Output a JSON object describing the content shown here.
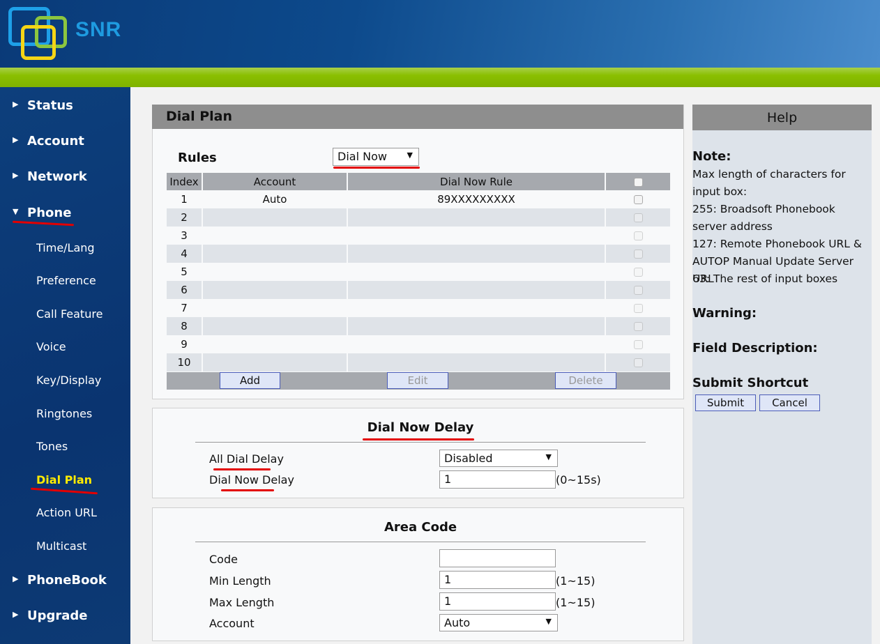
{
  "header": {
    "logo_text": "SNR"
  },
  "sidebar": {
    "items": [
      {
        "label": "Status"
      },
      {
        "label": "Account"
      },
      {
        "label": "Network"
      },
      {
        "label": "Phone"
      },
      {
        "label": "PhoneBook"
      },
      {
        "label": "Upgrade"
      }
    ],
    "phone_sub": [
      {
        "label": "Time/Lang"
      },
      {
        "label": "Preference"
      },
      {
        "label": "Call Feature"
      },
      {
        "label": "Voice"
      },
      {
        "label": "Key/Display"
      },
      {
        "label": "Ringtones"
      },
      {
        "label": "Tones"
      },
      {
        "label": "Dial Plan"
      },
      {
        "label": "Action URL"
      },
      {
        "label": "Multicast"
      }
    ]
  },
  "dialplan": {
    "title": "Dial Plan",
    "rules_label": "Rules",
    "rules_select": "Dial Now",
    "columns": [
      "Index",
      "Account",
      "Dial Now Rule"
    ],
    "rows": [
      {
        "index": "1",
        "account": "Auto",
        "rule": "89XXXXXXXXX"
      },
      {
        "index": "2",
        "account": "",
        "rule": ""
      },
      {
        "index": "3",
        "account": "",
        "rule": ""
      },
      {
        "index": "4",
        "account": "",
        "rule": ""
      },
      {
        "index": "5",
        "account": "",
        "rule": ""
      },
      {
        "index": "6",
        "account": "",
        "rule": ""
      },
      {
        "index": "7",
        "account": "",
        "rule": ""
      },
      {
        "index": "8",
        "account": "",
        "rule": ""
      },
      {
        "index": "9",
        "account": "",
        "rule": ""
      },
      {
        "index": "10",
        "account": "",
        "rule": ""
      }
    ],
    "buttons": {
      "add": "Add",
      "edit": "Edit",
      "delete": "Delete"
    }
  },
  "delay": {
    "title": "Dial Now Delay",
    "all_label": "All Dial Delay",
    "all_value": "Disabled",
    "now_label": "Dial Now Delay",
    "now_value": "1",
    "now_hint": "(0~15s)"
  },
  "area": {
    "title": "Area Code",
    "code_label": "Code",
    "code_value": "",
    "min_label": "Min Length",
    "min_value": "1",
    "min_hint": "(1~15)",
    "max_label": "Max Length",
    "max_value": "1",
    "max_hint": "(1~15)",
    "account_label": "Account",
    "account_value": "Auto"
  },
  "help": {
    "title": "Help",
    "note_label": "Note:",
    "note_lines": [
      "Max length of characters for input box:",
      "255: Broadsoft Phonebook server address",
      "127: Remote Phonebook URL & AUTOP Manual Update Server URL",
      "63: The rest of input boxes"
    ],
    "warning_label": "Warning:",
    "field_label": "Field Description:",
    "shortcut_label": "Submit Shortcut",
    "submit": "Submit",
    "cancel": "Cancel"
  }
}
